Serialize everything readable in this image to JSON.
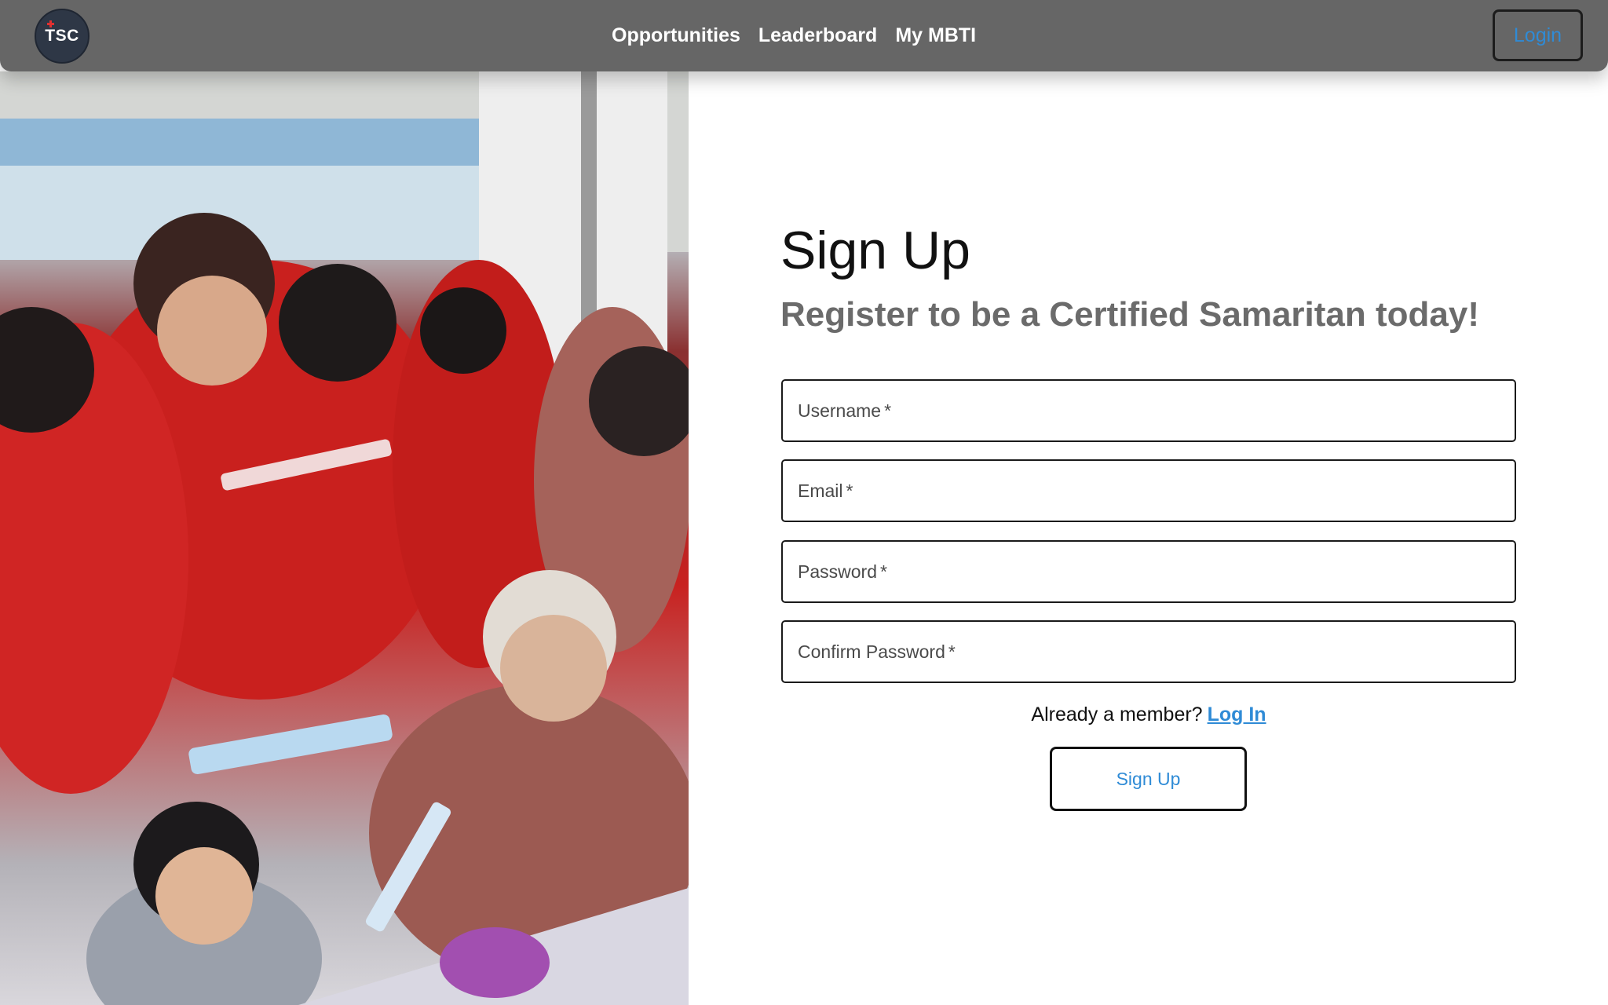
{
  "navbar": {
    "logo_text": "TSC",
    "links": [
      "Opportunities",
      "Leaderboard",
      "My MBTI"
    ],
    "login_label": "Login"
  },
  "photo": {
    "alt": "Volunteers in red shirts crafting loom bracelets with elderly participants and a child"
  },
  "form": {
    "title": "Sign Up",
    "subtitle": "Register to be a Certified Samaritan today!",
    "fields": [
      {
        "label": "Username",
        "required_mark": "*"
      },
      {
        "label": "Email",
        "required_mark": "*"
      },
      {
        "label": "Password",
        "required_mark": "*"
      },
      {
        "label": "Confirm Password",
        "required_mark": "*"
      }
    ],
    "member_prompt": "Already a member?",
    "login_link": "Log In",
    "submit_label": "Sign Up"
  },
  "colors": {
    "navbar_bg": "#666666",
    "link_blue": "#2f8bd6",
    "text_dark": "#111111",
    "subtitle_gray": "#6b6b6b"
  }
}
